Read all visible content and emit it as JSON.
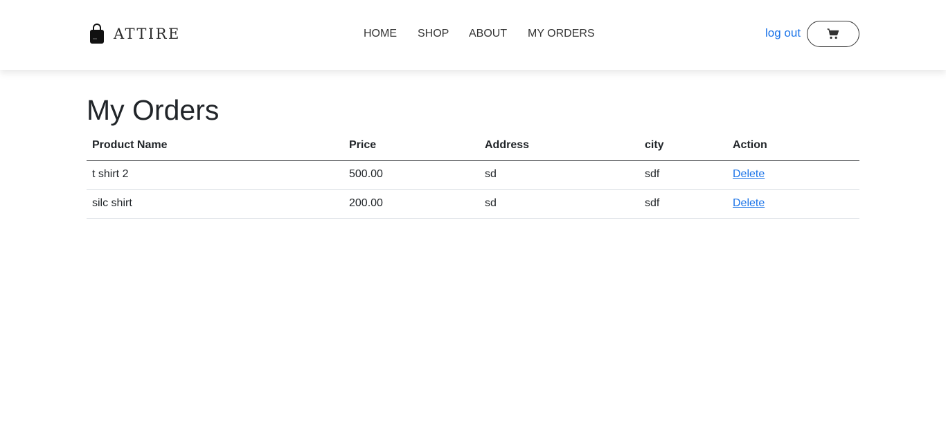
{
  "brand": {
    "name": "ATTIRE",
    "icon": "shopping-bag-icon"
  },
  "nav": {
    "items": [
      {
        "label": "HOME"
      },
      {
        "label": "SHOP"
      },
      {
        "label": "ABOUT"
      },
      {
        "label": "MY ORDERS"
      }
    ],
    "logout_label": "log out",
    "cart_icon": "shopping-cart-icon"
  },
  "page": {
    "title": "My Orders"
  },
  "orders_table": {
    "headers": [
      "Product Name",
      "Price",
      "Address",
      "city",
      "Action"
    ],
    "rows": [
      {
        "product": "t shirt 2",
        "price": "500.00",
        "address": "sd",
        "city": "sdf",
        "action": "Delete"
      },
      {
        "product": "silc shirt",
        "price": "200.00",
        "address": "sd",
        "city": "sdf",
        "action": "Delete"
      }
    ]
  },
  "colors": {
    "link": "#1a73e8",
    "text": "#212529",
    "row_border": "#dee2e6"
  }
}
